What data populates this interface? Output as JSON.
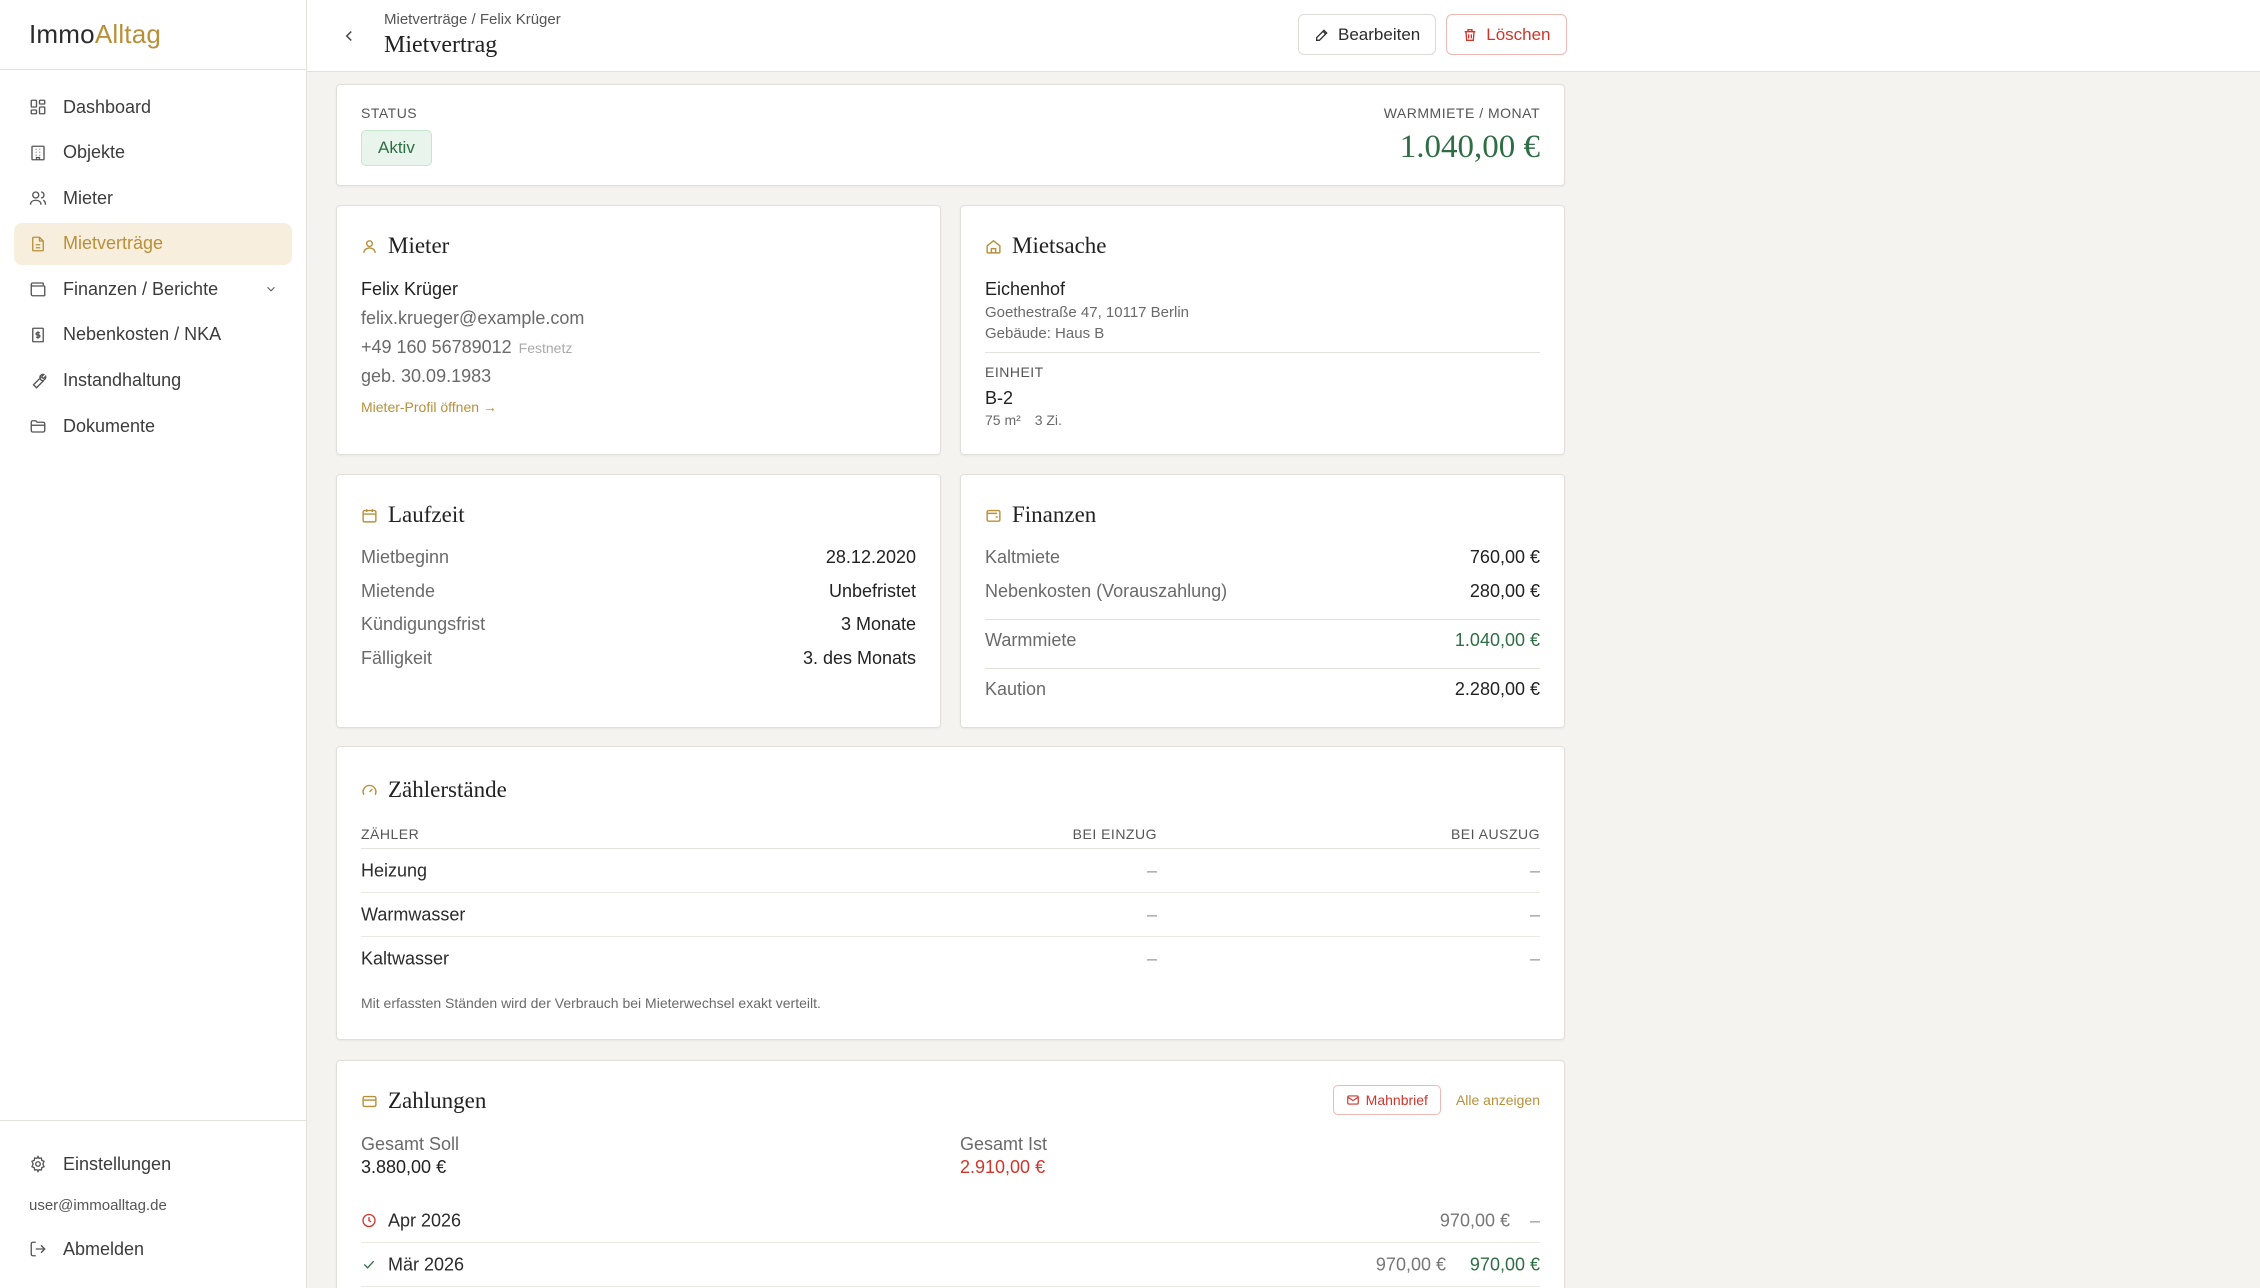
{
  "app": {
    "name_part1": "Immo",
    "name_part2": "Alltag"
  },
  "colors": {
    "accent": "#b8903a",
    "success": "#2f6e45",
    "danger": "#d0352b"
  },
  "nav": {
    "items": [
      {
        "label": "Dashboard",
        "icon": "grid-icon"
      },
      {
        "label": "Objekte",
        "icon": "building-icon"
      },
      {
        "label": "Mieter",
        "icon": "users-icon"
      },
      {
        "label": "Mietverträge",
        "icon": "document-icon",
        "active": true
      },
      {
        "label": "Finanzen / Berichte",
        "icon": "wallet-icon",
        "expandable": true
      },
      {
        "label": "Nebenkosten / NKA",
        "icon": "receipt-icon"
      },
      {
        "label": "Instandhaltung",
        "icon": "wrench-icon"
      },
      {
        "label": "Dokumente",
        "icon": "folder-icon"
      }
    ],
    "settings": "Einstellungen",
    "user_email": "user@immoalltag.de",
    "logout": "Abmelden"
  },
  "header": {
    "breadcrumb": "Mietverträge / Felix Krüger",
    "title": "Mietvertrag",
    "edit_label": "Bearbeiten",
    "delete_label": "Löschen"
  },
  "status_card": {
    "status_label": "STATUS",
    "status_value": "Aktiv",
    "amount_label": "WARMMIETE / MONAT",
    "amount": "1.040,00 €"
  },
  "tenant": {
    "title": "Mieter",
    "name": "Felix Krüger",
    "email": "felix.krueger@example.com",
    "phone": "+49 160 56789012",
    "phone_type": "Festnetz",
    "birth": "geb. 30.09.1983",
    "profile_link": "Mieter-Profil öffnen →"
  },
  "property": {
    "title": "Mietsache",
    "name": "Eichenhof",
    "address": "Goethestraße 47, 10117 Berlin",
    "building": "Gebäude: Haus B",
    "unit_label": "EINHEIT",
    "unit": "B-2",
    "area": "75 m²",
    "rooms": "3 Zi."
  },
  "term": {
    "title": "Laufzeit",
    "rows": [
      {
        "label": "Mietbeginn",
        "value": "28.12.2020"
      },
      {
        "label": "Mietende",
        "value": "Unbefristet"
      },
      {
        "label": "Kündigungsfrist",
        "value": "3 Monate"
      },
      {
        "label": "Fälligkeit",
        "value": "3. des Monats"
      }
    ]
  },
  "finance": {
    "title": "Finanzen",
    "cold_label": "Kaltmiete",
    "cold_value": "760,00 €",
    "extra_label": "Nebenkosten (Vorauszahlung)",
    "extra_value": "280,00 €",
    "warm_label": "Warmmiete",
    "warm_value": "1.040,00 €",
    "deposit_label": "Kaution",
    "deposit_value": "2.280,00 €"
  },
  "meters": {
    "title": "Zählerstände",
    "col_meter": "ZÄHLER",
    "col_in": "BEI EINZUG",
    "col_out": "BEI AUSZUG",
    "rows": [
      {
        "name": "Heizung",
        "in": "–",
        "out": "–"
      },
      {
        "name": "Warmwasser",
        "in": "–",
        "out": "–"
      },
      {
        "name": "Kaltwasser",
        "in": "–",
        "out": "–"
      }
    ],
    "note": "Mit erfassten Ständen wird der Verbrauch bei Mieterwechsel exakt verteilt."
  },
  "payments": {
    "title": "Zahlungen",
    "reminder_label": "Mahnbrief",
    "show_all": "Alle anzeigen",
    "target_label": "Gesamt Soll",
    "target_value": "3.880,00 €",
    "actual_label": "Gesamt Ist",
    "actual_value": "2.910,00 €",
    "rows": [
      {
        "month": "Apr 2026",
        "due": "970,00 €",
        "paid": "–",
        "state": "pending"
      },
      {
        "month": "Mär 2026",
        "due": "970,00 €",
        "paid": "970,00 €",
        "state": "paid"
      }
    ]
  }
}
